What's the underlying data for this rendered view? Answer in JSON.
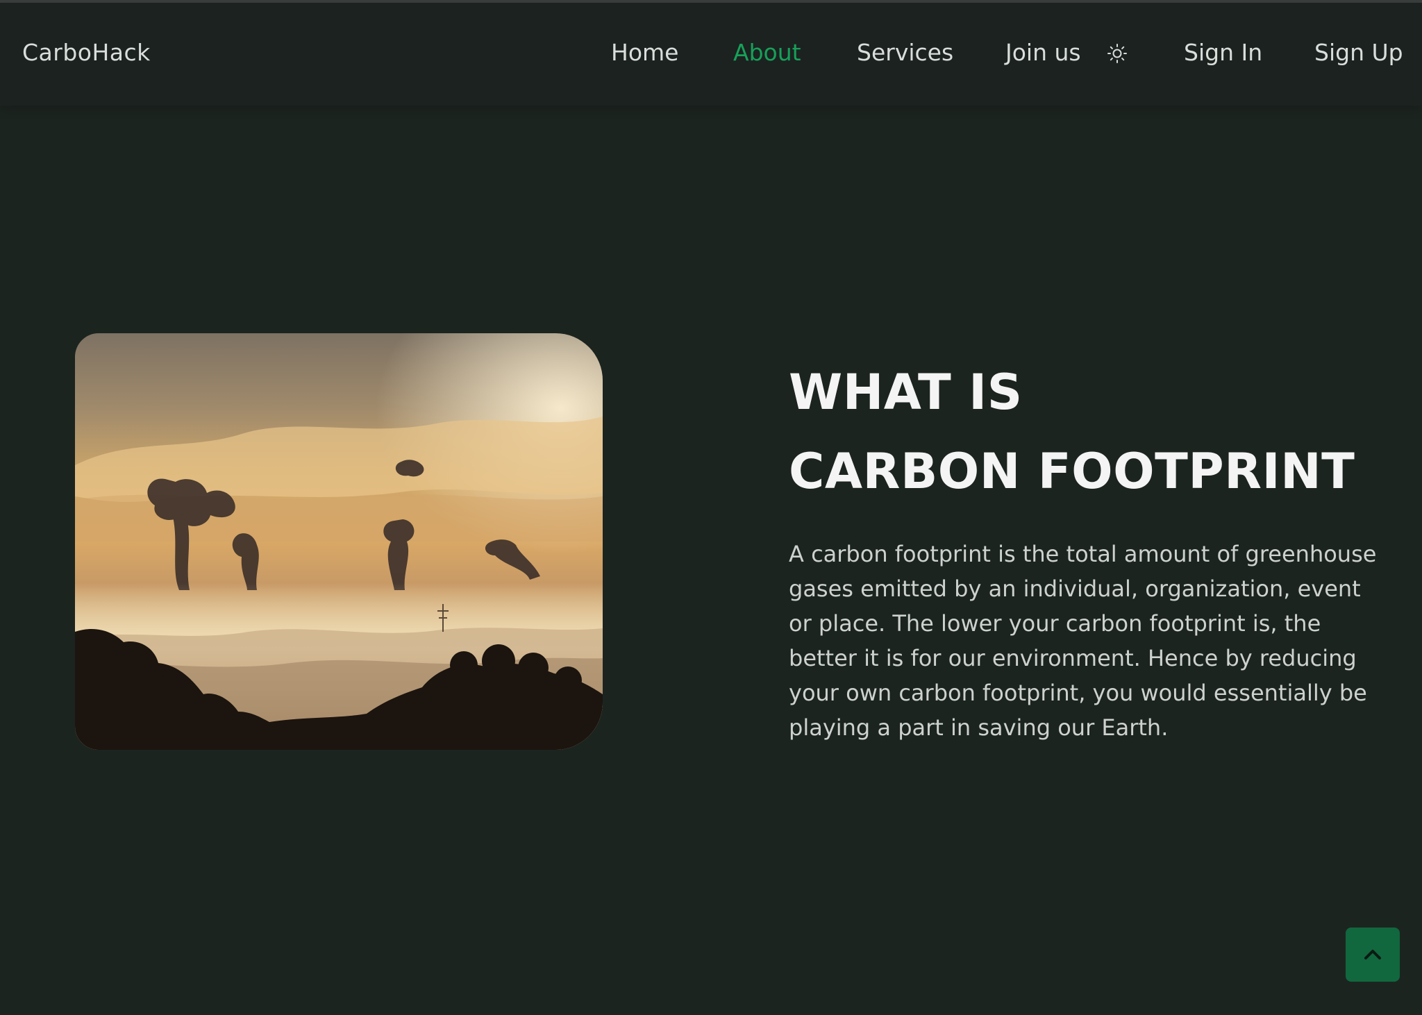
{
  "app": {
    "brand": "CarboHack"
  },
  "nav": {
    "items": [
      {
        "label": "Home",
        "active": false
      },
      {
        "label": "About",
        "active": true
      },
      {
        "label": "Services",
        "active": false
      },
      {
        "label": "Join us",
        "active": false
      }
    ],
    "theme_icon": "sun-icon",
    "sign_in": "Sign In",
    "sign_up": "Sign Up"
  },
  "hero": {
    "image_icon": "industrial-smoke-landscape-photo",
    "heading_line1": "WHAT IS",
    "heading_line2": "CARBON FOOTPRINT",
    "description": "A carbon footprint is the total amount of greenhouse gases emitted by an individual, organization, event or place. The lower your carbon footprint is, the better it is for our environment. Hence by reducing your own carbon footprint, you would essentially be playing a part in saving our Earth."
  },
  "scroll_top": {
    "icon": "chevron-up-icon"
  },
  "colors": {
    "background": "#1c2420",
    "accent": "#17a05a",
    "button": "#11683e",
    "text": "#d9dedb"
  }
}
